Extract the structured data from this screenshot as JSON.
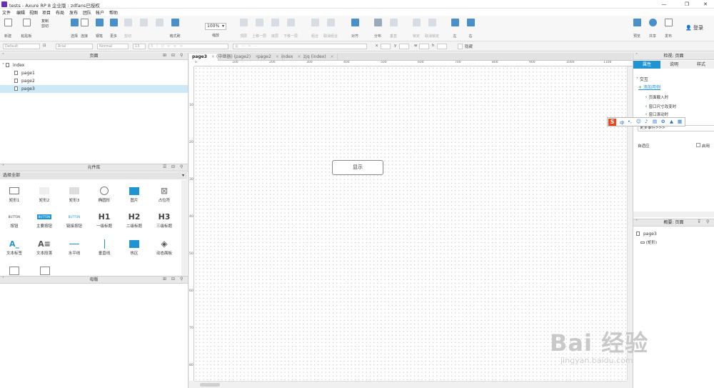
{
  "window": {
    "title": "tests - Axure RP 8 企业版 : zdfans已授权",
    "controls": [
      "—",
      "❐",
      "✕"
    ]
  },
  "menu": [
    "文件",
    "编辑",
    "视图",
    "项目",
    "布局",
    "发布",
    "团队",
    "帐户",
    "帮助"
  ],
  "toolbar": {
    "clipboard": {
      "paste": "粘贴板",
      "new": "新建",
      "copy": "复制",
      "cut": "剪切",
      "save": "保存",
      "format": "格式刷"
    },
    "tools": [
      "选择",
      "连接",
      "钢笔",
      "更多",
      "剪切",
      "",
      "",
      "格式刷"
    ],
    "zoom_value": "100%",
    "zoom_label": "缩放",
    "arrange": [
      "顶层",
      "上移一层",
      "底层",
      "下移一层",
      "组合",
      "取消组合",
      "对齐",
      "分布",
      "垂直",
      "锁定",
      "取消锁定",
      "左",
      "右"
    ],
    "right": {
      "preview": "预览",
      "share": "共享",
      "publish": "发布",
      "login": "登录"
    }
  },
  "formatbar": {
    "style": "Default",
    "font": "Arial",
    "weight": "Normal",
    "size": "13",
    "x_label": "x",
    "y_label": "y",
    "w_label": "w",
    "h_label": "h",
    "hidden_label": "隐藏"
  },
  "pages_panel": {
    "title": "页面",
    "items": [
      {
        "label": "index",
        "indent": 0
      },
      {
        "label": "page1",
        "indent": 1
      },
      {
        "label": "page2",
        "indent": 1
      },
      {
        "label": "page3",
        "indent": 1
      }
    ]
  },
  "widgets_panel": {
    "title": "元件库",
    "select_all": "选择全部",
    "items": [
      {
        "label": "矩形1",
        "glyph": ""
      },
      {
        "label": "矩形2",
        "glyph": ""
      },
      {
        "label": "矩形3",
        "glyph": ""
      },
      {
        "label": "椭圆形",
        "glyph": ""
      },
      {
        "label": "图片",
        "glyph": ""
      },
      {
        "label": "占位符",
        "glyph": ""
      },
      {
        "label": "按钮",
        "glyph": "BUTTON"
      },
      {
        "label": "主要按钮",
        "glyph": "BUTTON"
      },
      {
        "label": "链接按钮",
        "glyph": "BUTTON"
      },
      {
        "label": "一级标题",
        "glyph": "H1"
      },
      {
        "label": "二级标题",
        "glyph": "H2"
      },
      {
        "label": "三级标题",
        "glyph": "H3"
      },
      {
        "label": "文本标签",
        "glyph": "A_"
      },
      {
        "label": "文本段落",
        "glyph": "A≡"
      },
      {
        "label": "水平线",
        "glyph": ""
      },
      {
        "label": "垂直线",
        "glyph": ""
      },
      {
        "label": "热区",
        "glyph": ""
      },
      {
        "label": "动态面板",
        "glyph": ""
      }
    ]
  },
  "masters_panel": {
    "title": "母版"
  },
  "tabs": [
    {
      "label": "page3",
      "active": true
    },
    {
      "label": "(中继器) (page2)",
      "active": false
    },
    {
      "label": "page2",
      "active": false
    },
    {
      "label": "index",
      "active": false
    },
    {
      "label": "zjq (index)",
      "active": false
    }
  ],
  "ruler": {
    "h": [
      "0",
      "100",
      "200",
      "300",
      "400",
      "500",
      "600",
      "700",
      "800",
      "900",
      "1000",
      "1100"
    ],
    "v": [
      "100",
      "200",
      "300",
      "400",
      "500",
      "600",
      "700",
      "800"
    ]
  },
  "canvas": {
    "button_label": "显示"
  },
  "inspector": {
    "header": "检视: 页面",
    "tabs": [
      "属性",
      "说明",
      "样式"
    ],
    "section": "交互",
    "add_case": "添加用例",
    "events": [
      "页面载入时",
      "窗口尺寸改变时",
      "窗口滚动时"
    ],
    "more_events": "更多事件>>>",
    "adaptive": "自适应",
    "enabled": "启用"
  },
  "outline": {
    "header": "概要: 页面",
    "page": "page3",
    "child": "(矩形)"
  },
  "ime": {
    "brand": "S",
    "items": [
      "中",
      "•,",
      "☺",
      "♪",
      "▤",
      "✿",
      "▲",
      "▦"
    ]
  },
  "watermark": {
    "logo": "Bai 经验",
    "url": "jingyan.baidu.com"
  },
  "colors": {
    "accent": "#1f94d2",
    "selected_row": "#cde8f6",
    "axure_logo": "#6a2fb3"
  }
}
